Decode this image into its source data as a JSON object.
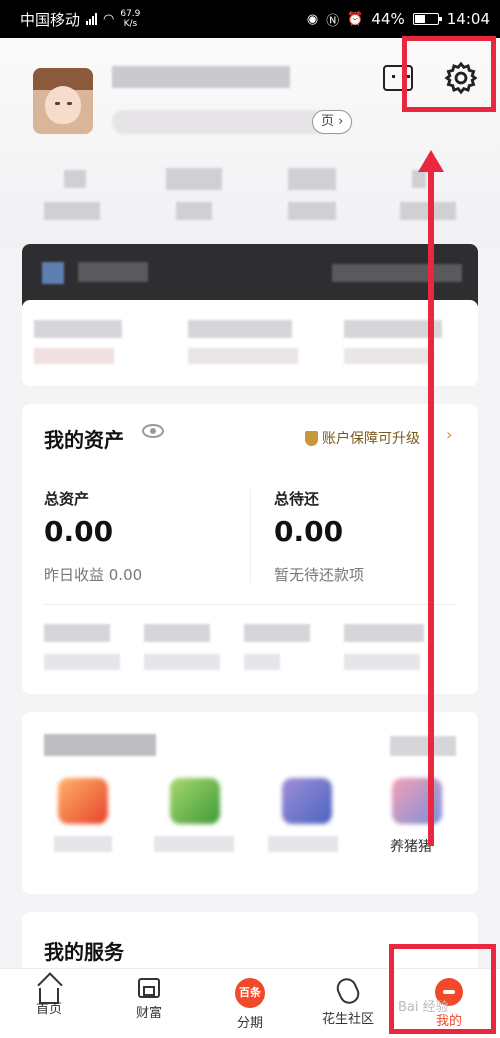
{
  "status_bar": {
    "carrier": "中国移动",
    "net_speed_value": "67.9",
    "net_speed_unit": "K/s",
    "battery": "44%",
    "time": "14:04"
  },
  "header": {
    "page_tag": "页"
  },
  "assets": {
    "title": "我的资产",
    "guarantee": "账户保障可升级",
    "total_assets_label": "总资产",
    "total_assets_value": "0.00",
    "yesterday_income": "昨日收益 0.00",
    "pending_repay_label": "总待还",
    "pending_repay_value": "0.00",
    "pending_repay_note": "暂无待还款项"
  },
  "apps_section": {
    "last_app_label": "养猪猪"
  },
  "services": {
    "title": "我的服务"
  },
  "tabbar": {
    "items": [
      {
        "label": "首页",
        "icon": "home-icon"
      },
      {
        "label": "财富",
        "icon": "wallet-icon"
      },
      {
        "label": "分期",
        "icon": "installment-icon",
        "badge": "百条"
      },
      {
        "label": "花生社区",
        "icon": "peanut-icon"
      },
      {
        "label": "我的",
        "icon": "profile-icon",
        "active": true
      }
    ]
  },
  "watermark": "Bai 经验",
  "colors": {
    "accent": "#f04a2a",
    "annotation": "#e8283f",
    "gold": "#c8963c"
  }
}
